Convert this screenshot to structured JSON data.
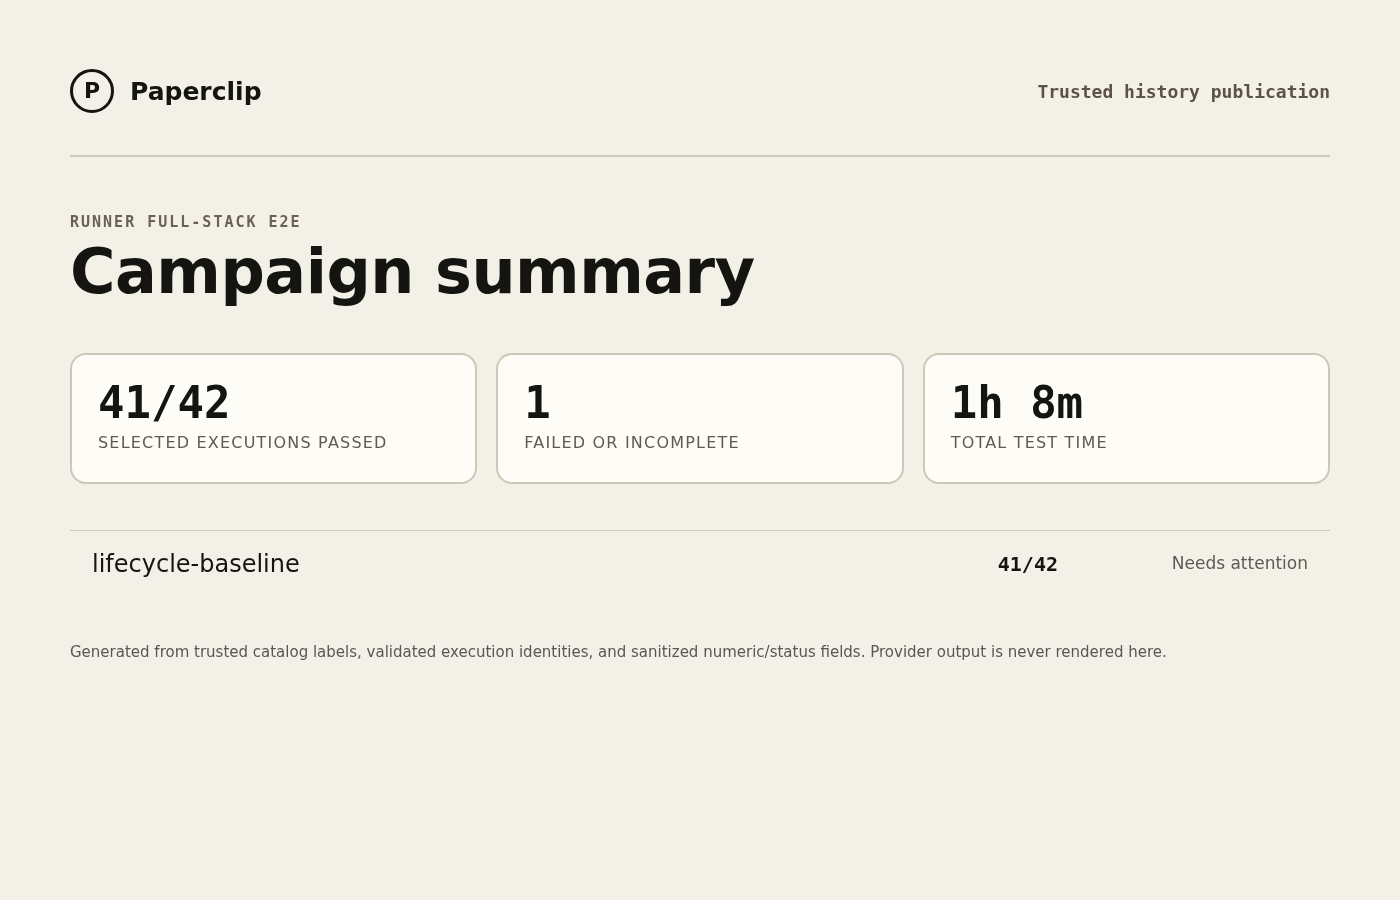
{
  "header": {
    "logo_mark": "P",
    "brand": "Paperclip",
    "tagline": "Trusted history publication"
  },
  "eyebrow": "RUNNER FULL-STACK E2E",
  "title": "Campaign summary",
  "stats": [
    {
      "value": "41/42",
      "label": "SELECTED EXECUTIONS PASSED"
    },
    {
      "value": "1",
      "label": "FAILED OR INCOMPLETE"
    },
    {
      "value": "1h 8m",
      "label": "TOTAL TEST TIME"
    }
  ],
  "campaigns": [
    {
      "name": "lifecycle-baseline",
      "passed": "41/42",
      "status": "Needs attention"
    }
  ],
  "footnote": "Generated from trusted catalog labels, validated execution identities, and sanitized numeric/status fields. Provider output is never rendered here."
}
